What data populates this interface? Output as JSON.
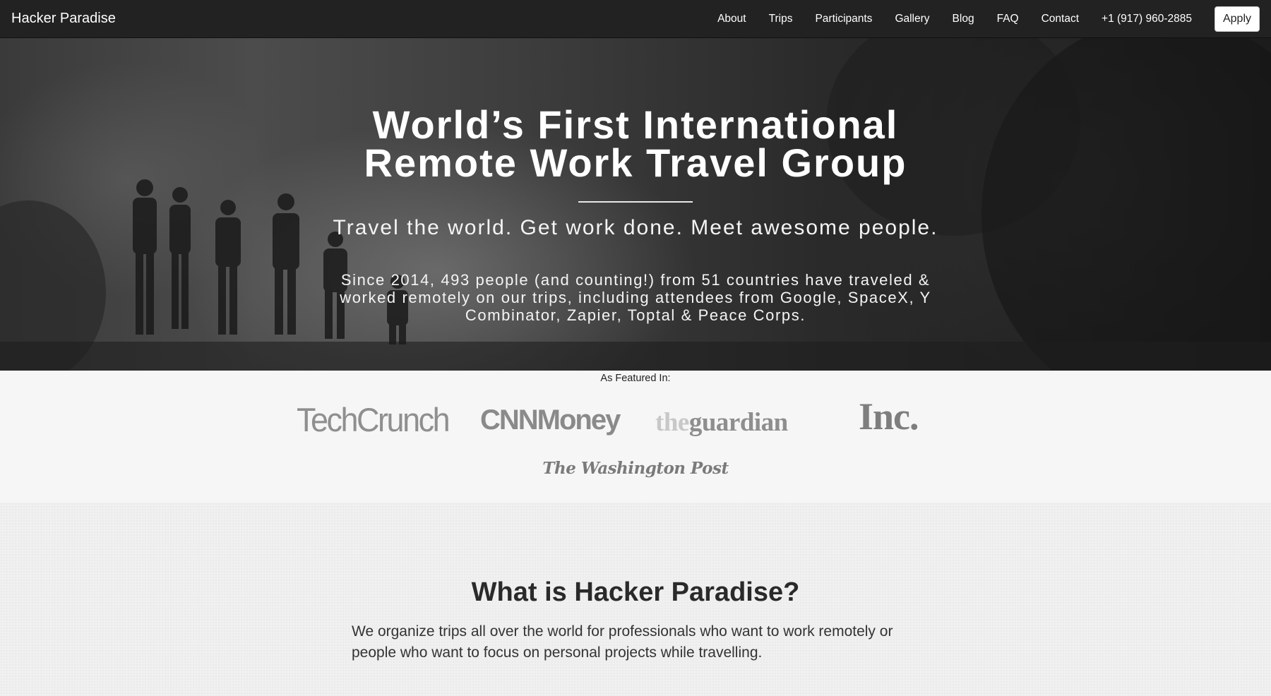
{
  "nav": {
    "brand": "Hacker Paradise",
    "links": [
      {
        "label": "About"
      },
      {
        "label": "Trips"
      },
      {
        "label": "Participants"
      },
      {
        "label": "Gallery"
      },
      {
        "label": "Blog"
      },
      {
        "label": "FAQ"
      },
      {
        "label": "Contact"
      },
      {
        "label": "+1 (917) 960-2885"
      }
    ],
    "apply_label": "Apply"
  },
  "hero": {
    "title_line1": "World’s First International",
    "title_line2": "Remote Work Travel Group",
    "tagline": "Travel the world. Get work done. Meet awesome people.",
    "description": "Since 2014, 493 people (and counting!) from 51 countries have traveled & worked remotely on our trips, including attendees from Google, SpaceX, Y Combinator, Zapier, Toptal & Peace Corps."
  },
  "featured": {
    "label": "As Featured In:",
    "logos": {
      "techcrunch": "TechCrunch",
      "cnnmoney": "CNNMoney",
      "guardian_the": "the",
      "guardian_name": "guardian",
      "inc": "Inc.",
      "wapo": "The Washington Post"
    }
  },
  "about": {
    "heading": "What is Hacker Paradise?",
    "text": "We organize trips all over the world for professionals who want to work remotely or people who want to focus on personal projects while travelling."
  },
  "colors": {
    "navbar_bg": "#222222",
    "hero_text": "#ffffff",
    "logo_gray": "#8a8a8a",
    "heading_text": "#2a2a2a"
  }
}
